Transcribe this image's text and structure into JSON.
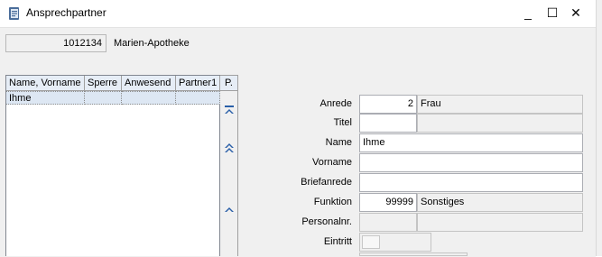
{
  "window": {
    "title": "Ansprechpartner",
    "minimize_glyph": "_",
    "maximize_glyph": "☐",
    "close_glyph": "✕"
  },
  "header": {
    "customer_number": "1012134",
    "customer_name": "Marien-Apotheke"
  },
  "grid": {
    "columns": [
      "Name, Vorname",
      "Sperre",
      "Anwesend",
      "Partner1",
      "P."
    ],
    "rows": [
      [
        "Ihme",
        "",
        "",
        "",
        ""
      ]
    ]
  },
  "form": {
    "anrede": {
      "label": "Anrede",
      "code": "2",
      "text": "Frau"
    },
    "titel": {
      "label": "Titel",
      "code": "",
      "text": ""
    },
    "name": {
      "label": "Name",
      "value": "Ihme"
    },
    "vorname": {
      "label": "Vorname",
      "value": ""
    },
    "briefanrede": {
      "label": "Briefanrede",
      "value": ""
    },
    "funktion": {
      "label": "Funktion",
      "code": "99999",
      "text": "Sonstiges"
    },
    "personalnr": {
      "label": "Personalnr.",
      "code": "",
      "text": ""
    },
    "eintritt": {
      "label": "Eintritt",
      "value": ""
    }
  },
  "icons": {
    "app": "contacts-app-icon",
    "nav_first": "first-record-icon",
    "nav_page_up": "page-up-icon",
    "nav_up": "previous-record-icon"
  }
}
